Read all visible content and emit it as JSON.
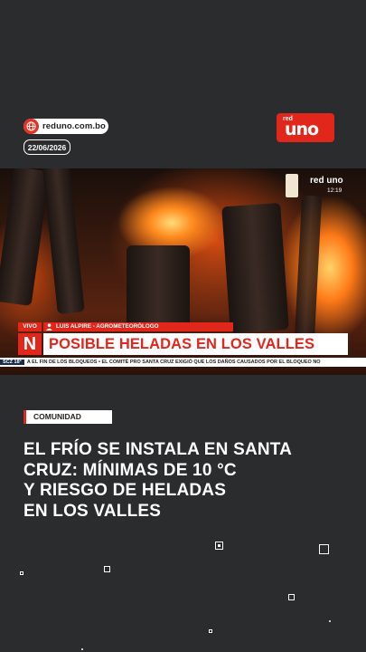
{
  "header": {
    "site": "reduno.com.bo",
    "date": "22/06/2026",
    "logo_small": "red",
    "logo_big": "uno"
  },
  "video": {
    "live_label": "VIVO",
    "person": "LUIS ALPIRE - AGROMETEORÓLOGO",
    "n_badge": "N",
    "headline": "POSIBLE HELADAS EN LOS VALLES",
    "ticker_region": "SCZ 18°",
    "ticker_text": "A EL FIN DE LOS BLOQUEOS   •   EL COMITÉ PRO SANTA CRUZ EXIGIÓ QUE LOS DAÑOS CAUSADOS POR EL BLOQUEO NO",
    "channel_time": "12:19",
    "channel_name": "red uno"
  },
  "article": {
    "category": "COMUNIDAD",
    "title_lines": [
      "EL FRÍO SE INSTALA EN SANTA",
      "CRUZ: MÍNIMAS DE 10 °C",
      "Y RIESGO DE HELADAS",
      "EN LOS VALLES"
    ]
  },
  "colors": {
    "accent": "#e1261c",
    "background": "#2b2c2e"
  },
  "icons": {
    "site": "globe-icon",
    "person": "person-icon"
  }
}
